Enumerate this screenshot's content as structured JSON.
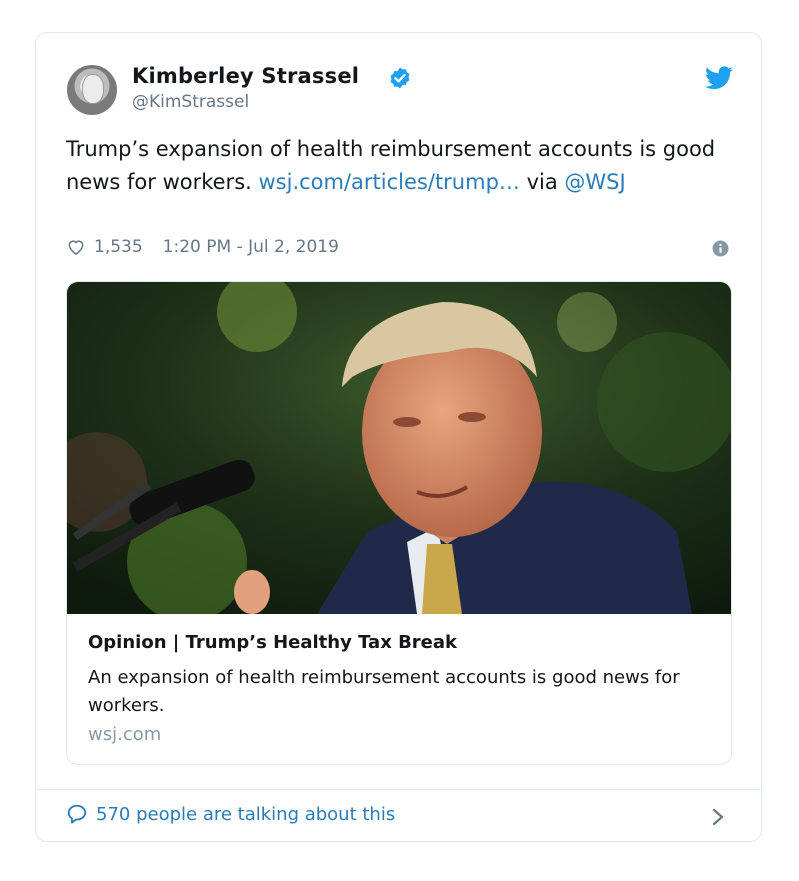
{
  "author": {
    "name": "Kimberley Strassel",
    "handle": "@KimStrassel"
  },
  "tweet": {
    "text_main": "Trump’s expansion of health reimbursement accounts is good news for workers.",
    "link": "wsj.com/articles/trump…",
    "via": "via",
    "mention": "@WSJ",
    "likes": "1,535",
    "timestamp": "1:20 PM - Jul 2, 2019"
  },
  "link_card": {
    "title": "Opinion | Trump’s Healthy Tax Break",
    "description": "An expansion of health reimbursement accounts is good news for workers.",
    "domain": "wsj.com"
  },
  "footer": {
    "talking": "570 people are talking about this"
  },
  "colors": {
    "link": "#2b7bb9",
    "verified": "#1da1f2",
    "muted": "#657786"
  },
  "icons": [
    "verified-badge-icon",
    "twitter-bird-icon",
    "heart-icon",
    "info-icon",
    "speech-bubble-icon",
    "chevron-right-icon"
  ]
}
